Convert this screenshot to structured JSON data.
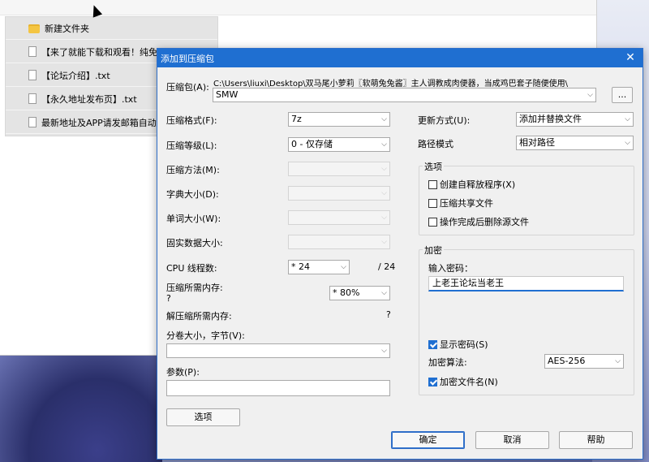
{
  "explorer": {
    "files": [
      {
        "icon": "folder-icon",
        "name": "新建文件夹"
      },
      {
        "icon": "txt-file-icon",
        "name": "【来了就能下载和观看！纯免"
      },
      {
        "icon": "txt-file-icon",
        "name": "【论坛介绍】.txt"
      },
      {
        "icon": "txt-file-icon",
        "name": "【永久地址发布页】.txt"
      },
      {
        "icon": "txt-file-icon",
        "name": "最新地址及APP请发邮箱自动"
      }
    ]
  },
  "dialog": {
    "title": "添加到压缩包",
    "archive_label": "压缩包(A):",
    "archive_path": "C:\\Users\\liuxi\\Desktop\\双马尾小萝莉〖软萌兔兔酱〗主人调教成肉便器，当成鸡巴套子随便使用\\",
    "archive_name": "SMW",
    "browse_label": "...",
    "left": {
      "format_label": "压缩格式(F):",
      "format_value": "7z",
      "level_label": "压缩等级(L):",
      "level_value": "0 - 仅存储",
      "method_label": "压缩方法(M):",
      "dict_label": "字典大小(D):",
      "word_label": "单词大小(W):",
      "solid_label": "固实数据大小:",
      "cpu_label": "CPU 线程数:",
      "cpu_value": "* 24",
      "cpu_total": "/ 24",
      "mem_label": "压缩所需内存:",
      "mem_q": "?",
      "mem_value": "* 80%",
      "dmem_label": "解压缩所需内存:",
      "dmem_q": "?",
      "volume_label": "分卷大小，字节(V):",
      "volume_value": "",
      "params_label": "参数(P):",
      "params_value": "",
      "options_button": "选项"
    },
    "right": {
      "update_label": "更新方式(U):",
      "update_value": "添加并替换文件",
      "path_label": "路径模式",
      "path_value": "相对路径",
      "options_group": "选项",
      "opt_sfx": "创建自释放程序(X)",
      "opt_shared": "压缩共享文件",
      "opt_delete": "操作完成后删除源文件",
      "encrypt_group": "加密",
      "pwd_label": "输入密码：",
      "pwd_value": "上老王论坛当老王",
      "show_pwd": "显示密码(S)",
      "enc_method_label": "加密算法:",
      "enc_method_value": "AES-256",
      "enc_names": "加密文件名(N)"
    },
    "buttons": {
      "ok": "确定",
      "cancel": "取消",
      "help": "帮助"
    }
  }
}
